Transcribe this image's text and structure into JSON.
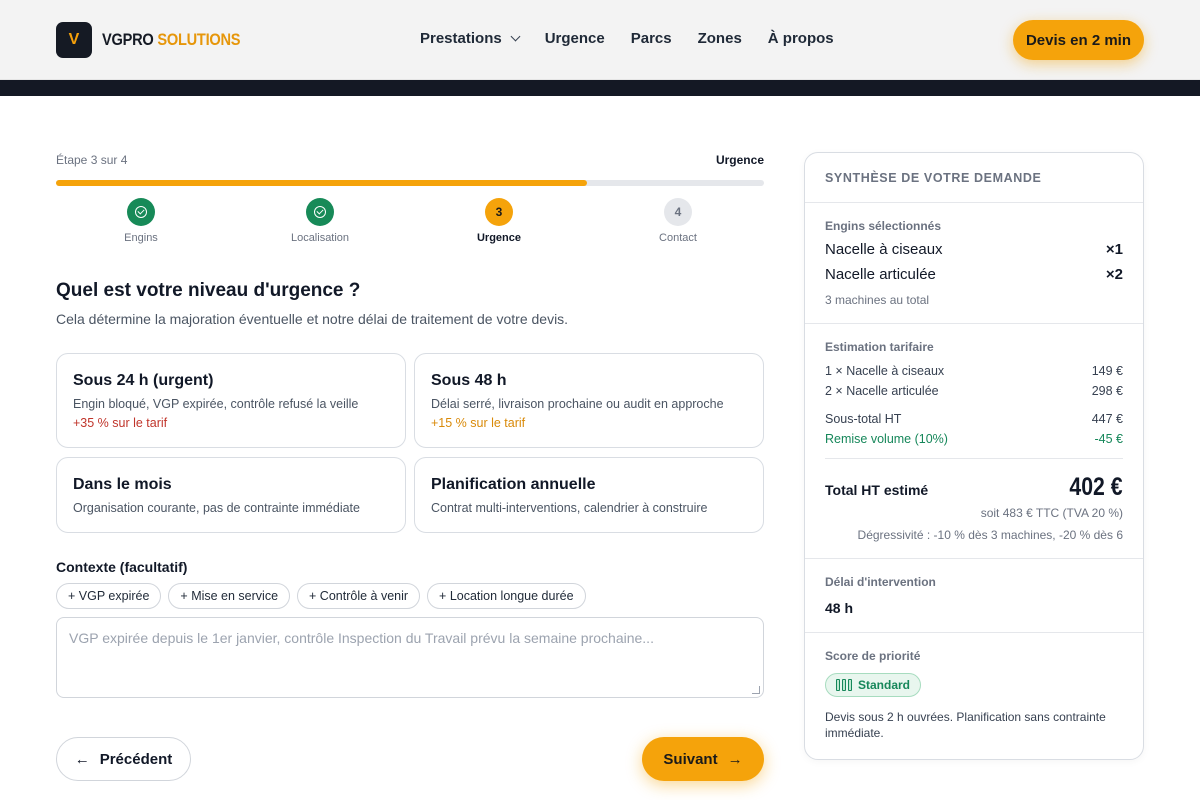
{
  "header": {
    "logo_letter": "V",
    "brand_part1": "VGPRO",
    "brand_part2": "SOLUTIONS",
    "nav": [
      "Prestations",
      "Urgence",
      "Parcs",
      "Zones",
      "À propos"
    ],
    "cta_label": "Devis en 2 min"
  },
  "progress": {
    "step_text": "Étape 3 sur 4",
    "current_label": "Urgence",
    "fraction": 0.75,
    "steps": [
      {
        "number": "1",
        "label": "Engins",
        "state": "done"
      },
      {
        "number": "2",
        "label": "Localisation",
        "state": "done"
      },
      {
        "number": "3",
        "label": "Urgence",
        "state": "active"
      },
      {
        "number": "4",
        "label": "Contact",
        "state": "todo"
      }
    ]
  },
  "question": {
    "title": "Quel est votre niveau d'urgence ?",
    "subtitle": "Cela détermine la majoration éventuelle et notre délai de traitement de votre devis."
  },
  "options": [
    {
      "title": "Sous 24 h (urgent)",
      "desc": "Engin bloqué, VGP expirée, contrôle refusé la veille",
      "extra": "+35 % sur le tarif"
    },
    {
      "title": "Sous 48 h",
      "desc": "Délai serré, livraison prochaine ou audit en approche",
      "extra": "+15 % sur le tarif"
    },
    {
      "title": "Dans le mois",
      "desc": "Organisation courante, pas de contrainte immédiate"
    },
    {
      "title": "Planification annuelle",
      "desc": "Contrat multi-interventions, calendrier à construire"
    }
  ],
  "context": {
    "label": "Contexte (facultatif)",
    "chips": [
      "+ VGP expirée",
      "+ Mise en service",
      "+ Contrôle à venir",
      "+ Location longue durée"
    ],
    "placeholder": "VGP expirée depuis le 1er janvier, contrôle Inspection du Travail prévu la semaine prochaine..."
  },
  "nav_buttons": {
    "prev": "Précédent",
    "next": "Suivant"
  },
  "summary": {
    "title": "SYNTHÈSE DE VOTRE DEMANDE",
    "engines_title": "Engins sélectionnés",
    "engines": [
      {
        "name": "Nacelle à ciseaux",
        "qty": "×1"
      },
      {
        "name": "Nacelle articulée",
        "qty": "×2"
      }
    ],
    "machines_total": "3 machines au total",
    "pricing_title": "Estimation tarifaire",
    "lines": [
      {
        "label": "1 × Nacelle à ciseaux",
        "value": "149 €"
      },
      {
        "label": "2 × Nacelle articulée",
        "value": "298 €"
      }
    ],
    "subtotal_label": "Sous-total HT",
    "subtotal_value": "447 €",
    "discount_label": "Remise volume (10%)",
    "discount_value": "-45 €",
    "total_label": "Total HT estimé",
    "total_value": "402 €",
    "ttc_note": "soit 483 € TTC (TVA 20 %)",
    "degressivity_note": "Dégressivité : -10 % dès 3 machines, -20 % dès 6",
    "delay_title": "Délai d'intervention",
    "delay_value": "48 h",
    "priority_title": "Score de priorité",
    "priority_badge": "Standard",
    "priority_note": "Devis sous 2 h ouvrées. Planification sans contrainte immédiate."
  }
}
